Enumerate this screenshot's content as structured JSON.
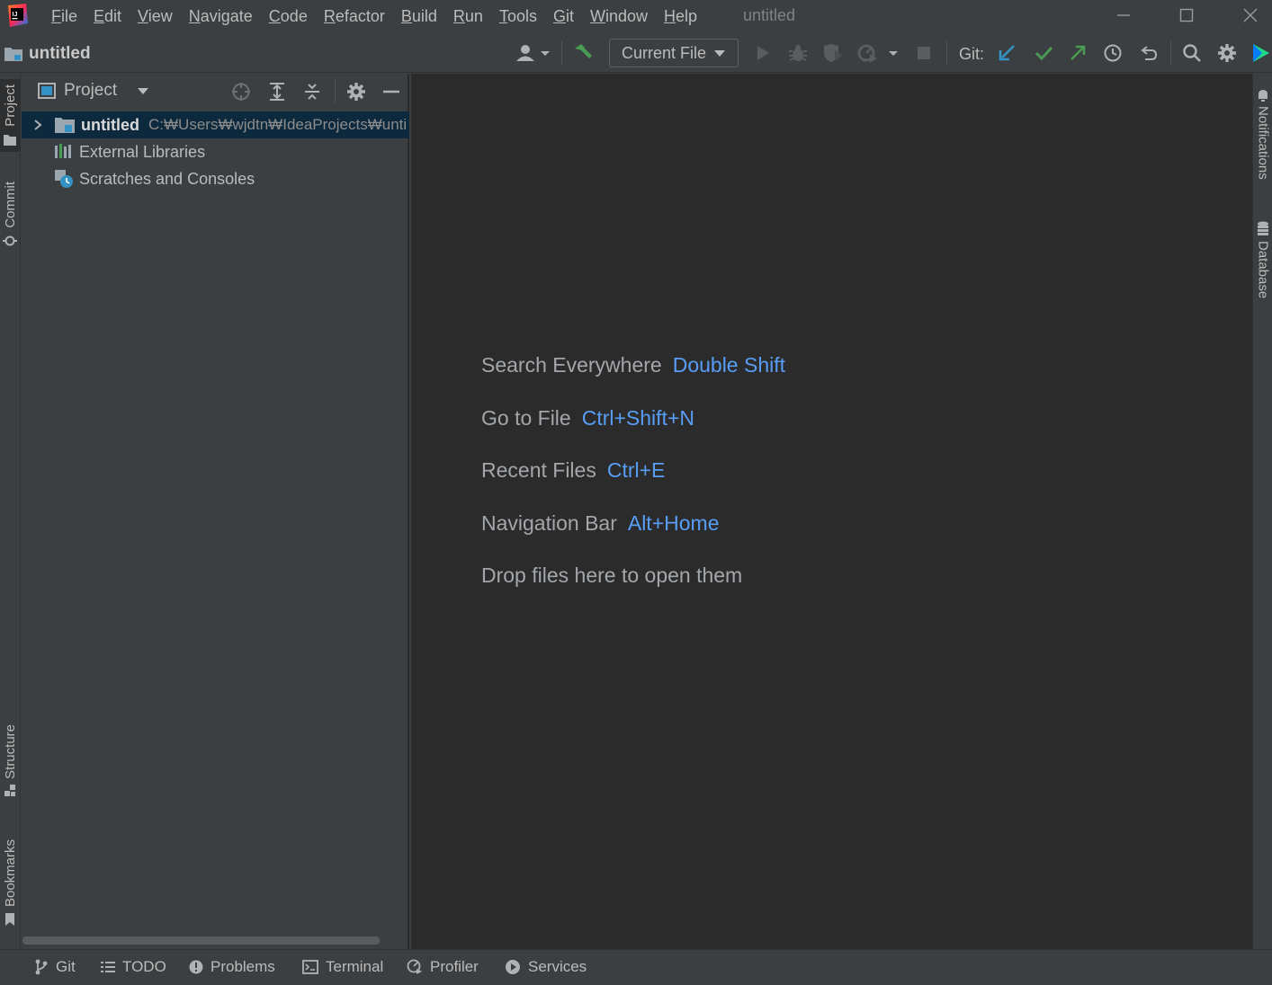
{
  "app": {
    "window_title": "untitled"
  },
  "menu": [
    {
      "mnemonic": "F",
      "rest": "ile"
    },
    {
      "mnemonic": "E",
      "rest": "dit"
    },
    {
      "mnemonic": "V",
      "rest": "iew"
    },
    {
      "mnemonic": "N",
      "rest": "avigate"
    },
    {
      "mnemonic": "C",
      "rest": "ode"
    },
    {
      "mnemonic": "R",
      "rest": "efactor"
    },
    {
      "mnemonic": "B",
      "rest": "uild"
    },
    {
      "mnemonic": "R",
      "rest": "un"
    },
    {
      "mnemonic": "T",
      "rest": "ools"
    },
    {
      "mnemonic": "G",
      "rest": "it"
    },
    {
      "mnemonic": "W",
      "rest": "indow"
    },
    {
      "mnemonic": "H",
      "rest": "elp"
    }
  ],
  "navbar": {
    "project_label": "untitled"
  },
  "toolbar": {
    "run_config": "Current File",
    "git_label": "Git:"
  },
  "left_stripe": {
    "project": "Project",
    "commit": "Commit",
    "structure": "Structure",
    "bookmarks": "Bookmarks"
  },
  "right_stripe": {
    "notifications": "Notifications",
    "database": "Database"
  },
  "project_panel": {
    "title": "Project",
    "tree": {
      "root_name": "untitled",
      "root_path": "C:₩Users₩wjdtn₩IdeaProjects₩unti",
      "external_libraries": "External Libraries",
      "scratches": "Scratches and Consoles"
    }
  },
  "editor_hints": [
    {
      "label": "Search Everywhere",
      "key": "Double Shift"
    },
    {
      "label": "Go to File",
      "key": "Ctrl+Shift+N"
    },
    {
      "label": "Recent Files",
      "key": "Ctrl+E"
    },
    {
      "label": "Navigation Bar",
      "key": "Alt+Home"
    },
    {
      "label": "Drop files here to open them",
      "key": ""
    }
  ],
  "bottom_tools": {
    "git": "Git",
    "todo": "TODO",
    "problems": "Problems",
    "terminal": "Terminal",
    "profiler": "Profiler",
    "services": "Services"
  },
  "colors": {
    "background": "#3c3f41",
    "editor": "#2b2b2b",
    "accent_key": "#589df6",
    "selection": "#0d293e",
    "build_green": "#499c54",
    "vcs_update_blue": "#3592c4"
  }
}
